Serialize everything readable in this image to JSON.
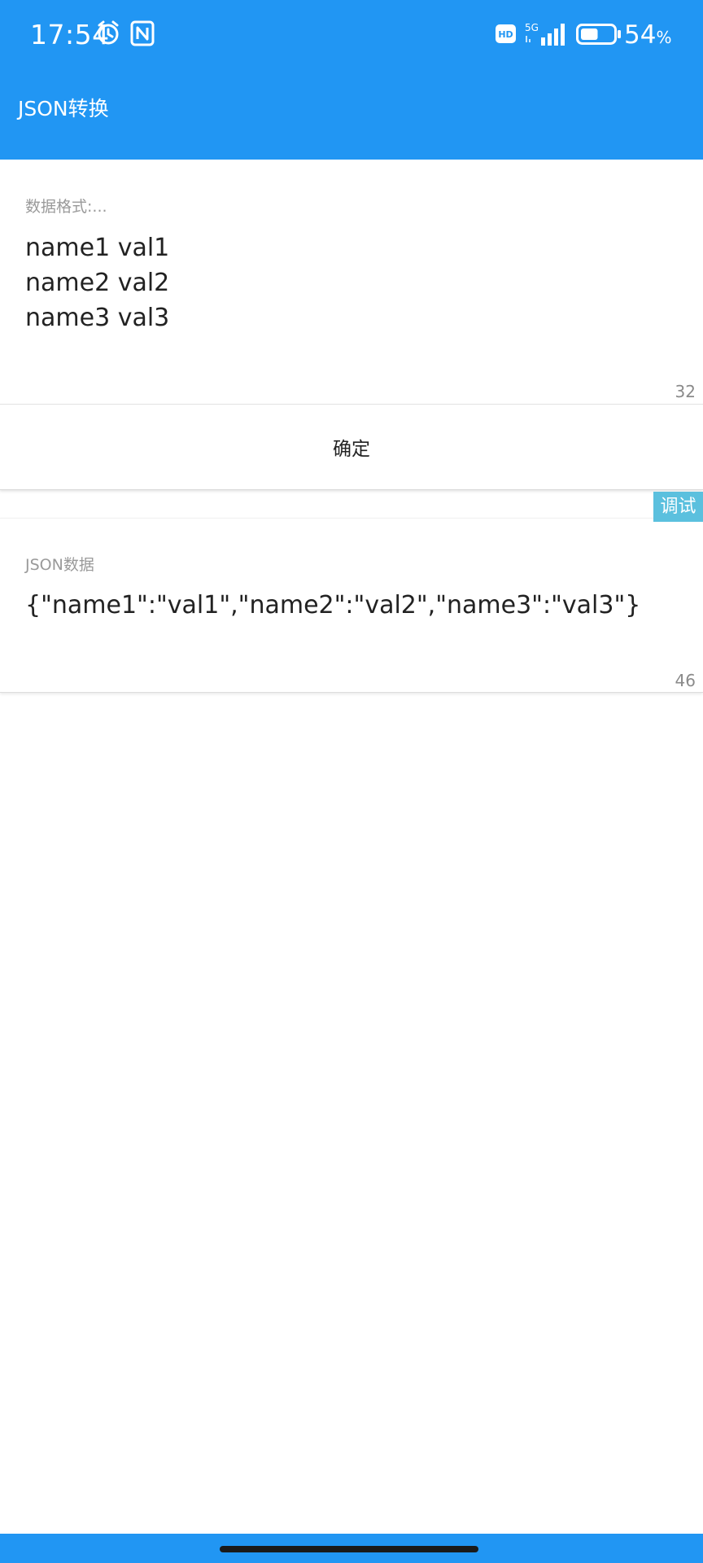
{
  "status_bar": {
    "time": "17:54",
    "hd_badge": "HD",
    "network": "5G",
    "battery_percent": "54",
    "battery_unit": "%",
    "battery_level": 0.54,
    "icons": [
      "alarm-icon",
      "nfc-icon",
      "hd-icon",
      "signal-icon",
      "battery-icon"
    ]
  },
  "app_bar": {
    "title": "JSON转换"
  },
  "input_card": {
    "label": "数据格式:...",
    "value": "name1 val1\nname2 val2\nname3 val3",
    "char_count": "32"
  },
  "confirm_button": {
    "label": "确定"
  },
  "debug_tag": {
    "label": "调试"
  },
  "output_card": {
    "label": "JSON数据",
    "value": "{\"name1\":\"val1\",\"name2\":\"val2\",\"name3\":\"val3\"}",
    "char_count": "46"
  },
  "colors": {
    "primary": "#2196f3",
    "debug_tag": "#5bc0de",
    "text": "#222222",
    "hint": "#9a9a9a"
  }
}
